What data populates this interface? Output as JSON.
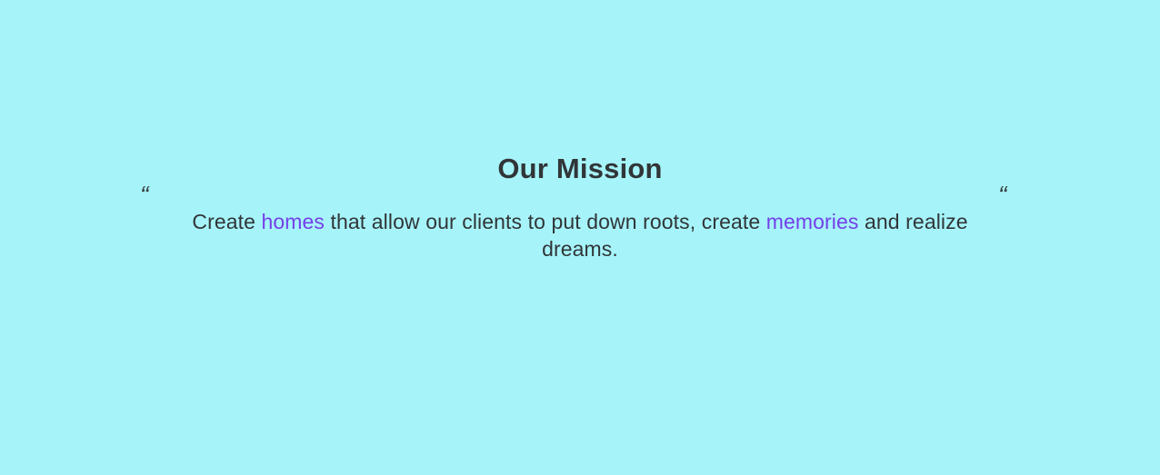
{
  "colors": {
    "background": "#a6f4f9",
    "text": "#313538",
    "accent": "#7440ea"
  },
  "mission": {
    "title": "Our Mission",
    "quote_open": "“",
    "quote_close": "“",
    "statement": {
      "part1": "Create ",
      "highlight1": "homes",
      "part2": " that allow our clients to put down roots, create ",
      "highlight2": "memories",
      "part3": " and realize dreams."
    }
  }
}
